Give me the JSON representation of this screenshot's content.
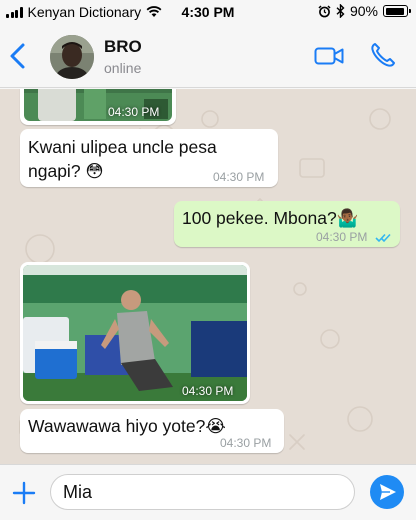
{
  "status_bar": {
    "carrier": "Kenyan Dictionary",
    "time": "4:30 PM",
    "battery": "90%",
    "battery_level": 0.9,
    "icons": [
      "signal-icon",
      "wifi-icon",
      "alarm-icon",
      "bluetooth-icon",
      "battery-icon"
    ]
  },
  "header": {
    "contact_name": "BRO",
    "contact_status": "online",
    "icons": [
      "back-chevron-icon",
      "video-call-icon",
      "phone-call-icon"
    ],
    "accent_color": "#1a7cf5"
  },
  "messages": [
    {
      "type": "image",
      "direction": "in",
      "time": "04:30 PM"
    },
    {
      "type": "text",
      "direction": "in",
      "line1": "Kwani ulipea uncle pesa",
      "line2": "ngapi? 😳",
      "time": "04:30 PM"
    },
    {
      "type": "text",
      "direction": "out",
      "text": "100 pekee. Mbona?🤷🏾‍♂️",
      "time": "04:30 PM",
      "status_icon": "double-check-read-icon"
    },
    {
      "type": "image",
      "direction": "in",
      "time": "04:30 PM"
    },
    {
      "type": "text",
      "direction": "in",
      "text": "Wawawawa hiyo yote?😭",
      "time": "04:30 PM"
    }
  ],
  "composer": {
    "value": "Mia",
    "icons": [
      "plus-icon",
      "send-icon"
    ]
  },
  "colors": {
    "chat_background": "#e5ddd5",
    "incoming_bubble": "#ffffff",
    "outgoing_bubble": "#dcf8c6",
    "read_ticks": "#34b7f1"
  }
}
